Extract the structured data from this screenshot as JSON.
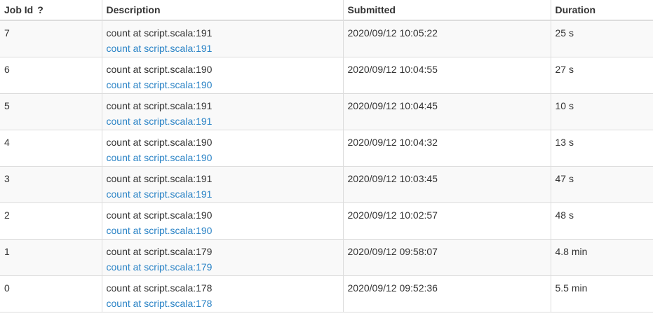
{
  "headers": {
    "job_id": "Job Id",
    "job_id_help": "?",
    "description": "Description",
    "submitted": "Submitted",
    "duration": "Duration"
  },
  "rows": [
    {
      "id": "7",
      "desc": "count at script.scala:191",
      "link": "count at script.scala:191",
      "submitted": "2020/09/12 10:05:22",
      "duration": "25 s"
    },
    {
      "id": "6",
      "desc": "count at script.scala:190",
      "link": "count at script.scala:190",
      "submitted": "2020/09/12 10:04:55",
      "duration": "27 s"
    },
    {
      "id": "5",
      "desc": "count at script.scala:191",
      "link": "count at script.scala:191",
      "submitted": "2020/09/12 10:04:45",
      "duration": "10 s"
    },
    {
      "id": "4",
      "desc": "count at script.scala:190",
      "link": "count at script.scala:190",
      "submitted": "2020/09/12 10:04:32",
      "duration": "13 s"
    },
    {
      "id": "3",
      "desc": "count at script.scala:191",
      "link": "count at script.scala:191",
      "submitted": "2020/09/12 10:03:45",
      "duration": "47 s"
    },
    {
      "id": "2",
      "desc": "count at script.scala:190",
      "link": "count at script.scala:190",
      "submitted": "2020/09/12 10:02:57",
      "duration": "48 s"
    },
    {
      "id": "1",
      "desc": "count at script.scala:179",
      "link": "count at script.scala:179",
      "submitted": "2020/09/12 09:58:07",
      "duration": "4.8 min"
    },
    {
      "id": "0",
      "desc": "count at script.scala:178",
      "link": "count at script.scala:178",
      "submitted": "2020/09/12 09:52:36",
      "duration": "5.5 min"
    }
  ]
}
